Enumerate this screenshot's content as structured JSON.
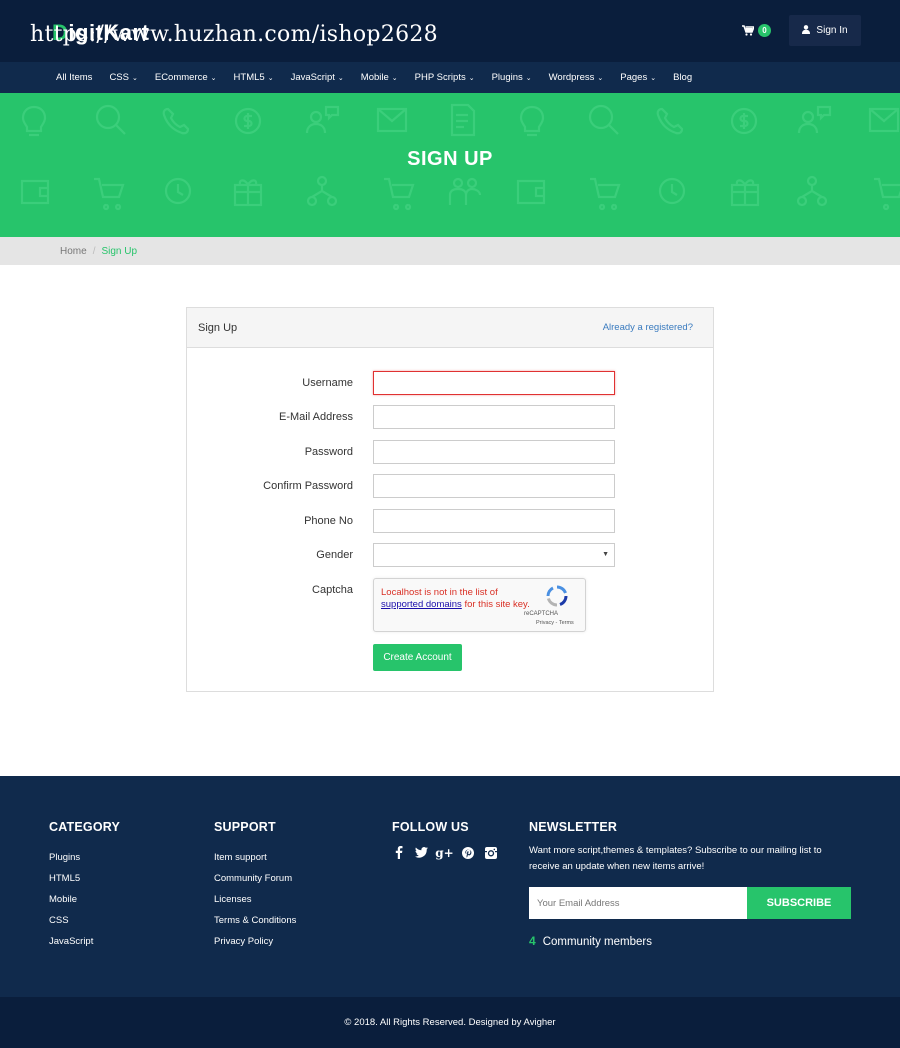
{
  "header": {
    "logo_first_letter": "D",
    "logo_rest": "igitKart",
    "watermark": "https://www.huzhan.com/ishop2628",
    "cart_count": "0",
    "signin_label": "Sign In"
  },
  "nav": {
    "items": [
      {
        "label": "All Items",
        "dropdown": false
      },
      {
        "label": "CSS",
        "dropdown": true
      },
      {
        "label": "ECommerce",
        "dropdown": true
      },
      {
        "label": "HTML5",
        "dropdown": true
      },
      {
        "label": "JavaScript",
        "dropdown": true
      },
      {
        "label": "Mobile",
        "dropdown": true
      },
      {
        "label": "PHP Scripts",
        "dropdown": true
      },
      {
        "label": "Plugins",
        "dropdown": true
      },
      {
        "label": "Wordpress",
        "dropdown": true
      },
      {
        "label": "Pages",
        "dropdown": true
      },
      {
        "label": "Blog",
        "dropdown": false
      }
    ]
  },
  "hero": {
    "title": "SIGN UP"
  },
  "breadcrumb": {
    "home": "Home",
    "separator": "/",
    "current": "Sign Up"
  },
  "panel": {
    "title": "Sign Up",
    "registered_link": "Already a registered?",
    "fields": [
      {
        "label": "Username",
        "value": "",
        "invalid": true
      },
      {
        "label": "E-Mail Address",
        "value": "",
        "invalid": false
      },
      {
        "label": "Password",
        "value": "",
        "invalid": false
      },
      {
        "label": "Confirm Password",
        "value": "",
        "invalid": false
      },
      {
        "label": "Phone No",
        "value": "",
        "invalid": false
      }
    ],
    "gender_label": "Gender",
    "gender_value": "",
    "captcha_label": "Captcha",
    "captcha": {
      "msg_before": "Localhost is not in the list of ",
      "msg_link": "supported domains",
      "msg_after": " for this site key.",
      "brand": "reCAPTCHA",
      "terms": "Privacy - Terms"
    },
    "submit_label": "Create Account"
  },
  "footer": {
    "category": {
      "title": "CATEGORY",
      "links": [
        "Plugins",
        "HTML5",
        "Mobile",
        "CSS",
        "JavaScript"
      ]
    },
    "support": {
      "title": "SUPPORT",
      "links": [
        "Item support",
        "Community Forum",
        "Licenses",
        "Terms & Conditions",
        "Privacy Policy"
      ]
    },
    "follow": {
      "title": "FOLLOW US",
      "icons": [
        "facebook-icon",
        "twitter-icon",
        "google-plus-icon",
        "pinterest-icon",
        "instagram-icon"
      ]
    },
    "newsletter": {
      "title": "NEWSLETTER",
      "text": "Want more script,themes & templates? Subscribe to our mailing list to receive an update when new items arrive!",
      "placeholder": "Your Email Address",
      "button": "SUBSCRIBE",
      "community_count": "4",
      "community_label": "Community members"
    },
    "copyright": "© 2018. All Rights Reserved. Designed by Avigher"
  },
  "colors": {
    "brand_green": "#27c46b",
    "navy": "#102a4c",
    "dark_navy": "#0a1e3c",
    "link_blue": "#3a7bbf",
    "error_red": "#e03131"
  }
}
